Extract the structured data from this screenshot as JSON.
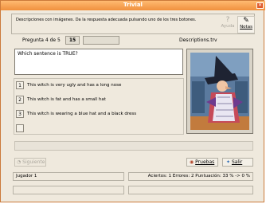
{
  "window": {
    "title": "Trivial"
  },
  "toolbar": {
    "instructions": "Descripciones con imágenes. Da la respuesta adecuada pulsando uno de los tres botones.",
    "help_label": "Ayuda",
    "notes_label": "Notas"
  },
  "status": {
    "question_counter": "Pregunta 4 de 5",
    "score_value": "15",
    "file_name": "Descriptions.trv"
  },
  "question": {
    "text": "Which sentence is TRUE?"
  },
  "answers": [
    {
      "number": "1",
      "text": "This witch is very ugly and has a long nose"
    },
    {
      "number": "2",
      "text": "This witch is fat and has a small hat"
    },
    {
      "number": "3",
      "text": "This witch is wearing a blue hat and a black dress"
    }
  ],
  "footer": {
    "continue_label": "Siguiente",
    "tests_label": "Pruebas",
    "exit_label": "Salir",
    "player": "Jugador 1",
    "results": "Aciertos: 1   Errores: 2   Puntuación: 33 % -> 0 %"
  },
  "icons": {
    "close": "close-icon",
    "help": "help-icon",
    "notes": "notes-icon",
    "tests": "tests-icon",
    "exit": "exit-icon"
  }
}
